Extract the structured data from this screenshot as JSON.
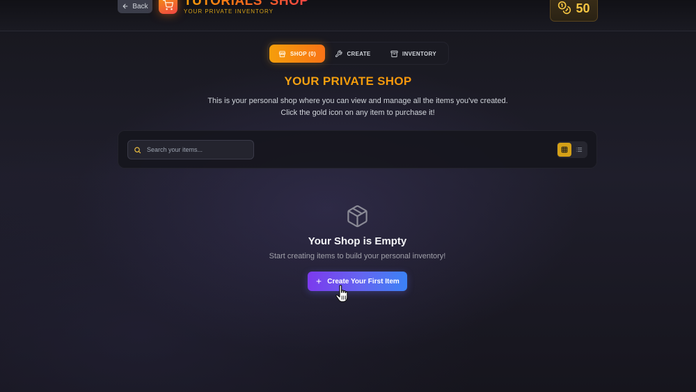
{
  "header": {
    "back_label": "Back",
    "shop_title": "TUTORIALS' SHOP",
    "shop_subtitle": "YOUR PRIVATE INVENTORY",
    "coins": "50"
  },
  "tabs": [
    {
      "label": "SHOP (0)",
      "icon": "store-icon",
      "active": true
    },
    {
      "label": "CREATE",
      "icon": "wrench-icon",
      "active": false
    },
    {
      "label": "INVENTORY",
      "icon": "archive-box-icon",
      "active": false
    }
  ],
  "main": {
    "title": "YOUR PRIVATE SHOP",
    "description": "This is your personal shop where you can view and manage all the items you've created. Click the gold icon on any item to purchase it!"
  },
  "search": {
    "placeholder": "Search your items...",
    "value": ""
  },
  "view_toggle": {
    "selected": "grid",
    "options": [
      "grid",
      "list"
    ]
  },
  "empty_state": {
    "icon": "package-icon",
    "title": "Your Shop is Empty",
    "description": "Start creating items to build your personal inventory!",
    "button_label": "Create Your First Item"
  },
  "colors": {
    "accent_gold": "#f59e0b",
    "accent_orange": "#f97316",
    "button_purple": "#7c3aed",
    "button_blue": "#3b82f6",
    "background": "#1c1b26"
  }
}
